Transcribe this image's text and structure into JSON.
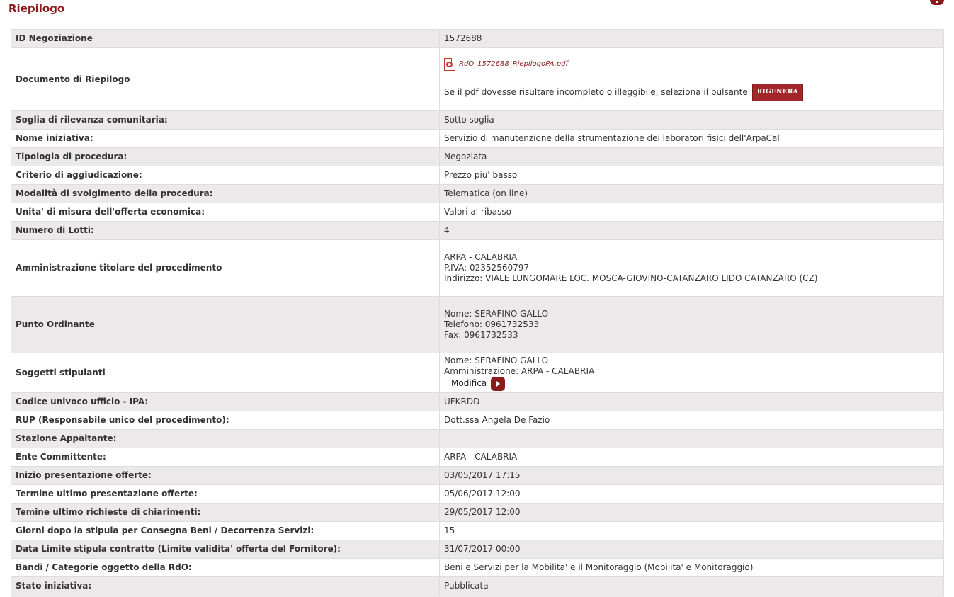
{
  "page": {
    "title": "Riepilogo"
  },
  "rows": {
    "id_negoziazione": {
      "label": "ID Negoziazione",
      "value": "1572688"
    },
    "documento": {
      "label": "Documento di Riepilogo",
      "pdf_link": "RdO_1572688_RiepilogoPA.pdf",
      "note": "Se il pdf dovesse risultare incompleto o illeggibile, seleziona il pulsante",
      "button": "RIGENERA"
    },
    "soglia": {
      "label": "Soglia di rilevanza comunitaria:",
      "value": "Sotto soglia"
    },
    "nome_iniziativa": {
      "label": "Nome iniziativa:",
      "value": "Servizio di manutenzione della strumentazione dei laboratori fisici dell'ArpaCal"
    },
    "tipologia": {
      "label": "Tipologia di procedura:",
      "value": "Negoziata"
    },
    "criterio": {
      "label": "Criterio di aggiudicazione:",
      "value": "Prezzo piu' basso"
    },
    "modalita": {
      "label": "Modalità di svolgimento della procedura:",
      "value": "Telematica (on line)"
    },
    "unita": {
      "label": "Unita' di misura dell'offerta economica:",
      "value": "Valori al ribasso"
    },
    "lotti": {
      "label": "Numero di Lotti:",
      "value": "4"
    },
    "amministrazione": {
      "label": "Amministrazione titolare del procedimento",
      "name": "ARPA - CALABRIA",
      "piva": "P.IVA: 02352560797",
      "indirizzo": "Indirizzo: VIALE LUNGOMARE LOC. MOSCA-GIOVINO-CATANZARO LIDO CATANZARO (CZ)"
    },
    "punto_ordinante": {
      "label": "Punto Ordinante",
      "nome": "Nome: SERAFINO GALLO",
      "telefono": "Telefono: 0961732533",
      "fax": "Fax: 0961732533"
    },
    "soggetti": {
      "label": "Soggetti stipulanti",
      "nome": "Nome: SERAFINO GALLO",
      "amministrazione": "Amministrazione: ARPA - CALABRIA",
      "modifica": "Modifica"
    },
    "ipa": {
      "label": "Codice univoco ufficio - IPA:",
      "value": "UFKRDD"
    },
    "rup": {
      "label": "RUP (Responsabile unico del procedimento):",
      "value": "Dott.ssa Angela De Fazio"
    },
    "stazione": {
      "label": "Stazione Appaltante:",
      "value": ""
    },
    "ente": {
      "label": "Ente Committente:",
      "value": "ARPA - CALABRIA"
    },
    "inizio": {
      "label": "Inizio presentazione offerte:",
      "value": "03/05/2017 17:15"
    },
    "termine": {
      "label": "Termine ultimo presentazione offerte:",
      "value": "05/06/2017 12:00"
    },
    "chiarimenti": {
      "label": "Temine ultimo richieste di chiarimenti:",
      "value": "29/05/2017 12:00"
    },
    "giorni": {
      "label": "Giorni dopo la stipula per Consegna Beni / Decorrenza Servizi:",
      "value": "15"
    },
    "data_limite": {
      "label": "Data Limite stipula contratto (Limite validita' offerta del Fornitore):",
      "value": "31/07/2017 00:00"
    },
    "bandi": {
      "label": "Bandi / Categorie oggetto della RdO:",
      "value": "Beni e Servizi per la Mobilita' e il Monitoraggio (Mobilita' e Monitoraggio)"
    },
    "stato": {
      "label": "Stato iniziativa:",
      "value": "Pubblicata"
    }
  }
}
